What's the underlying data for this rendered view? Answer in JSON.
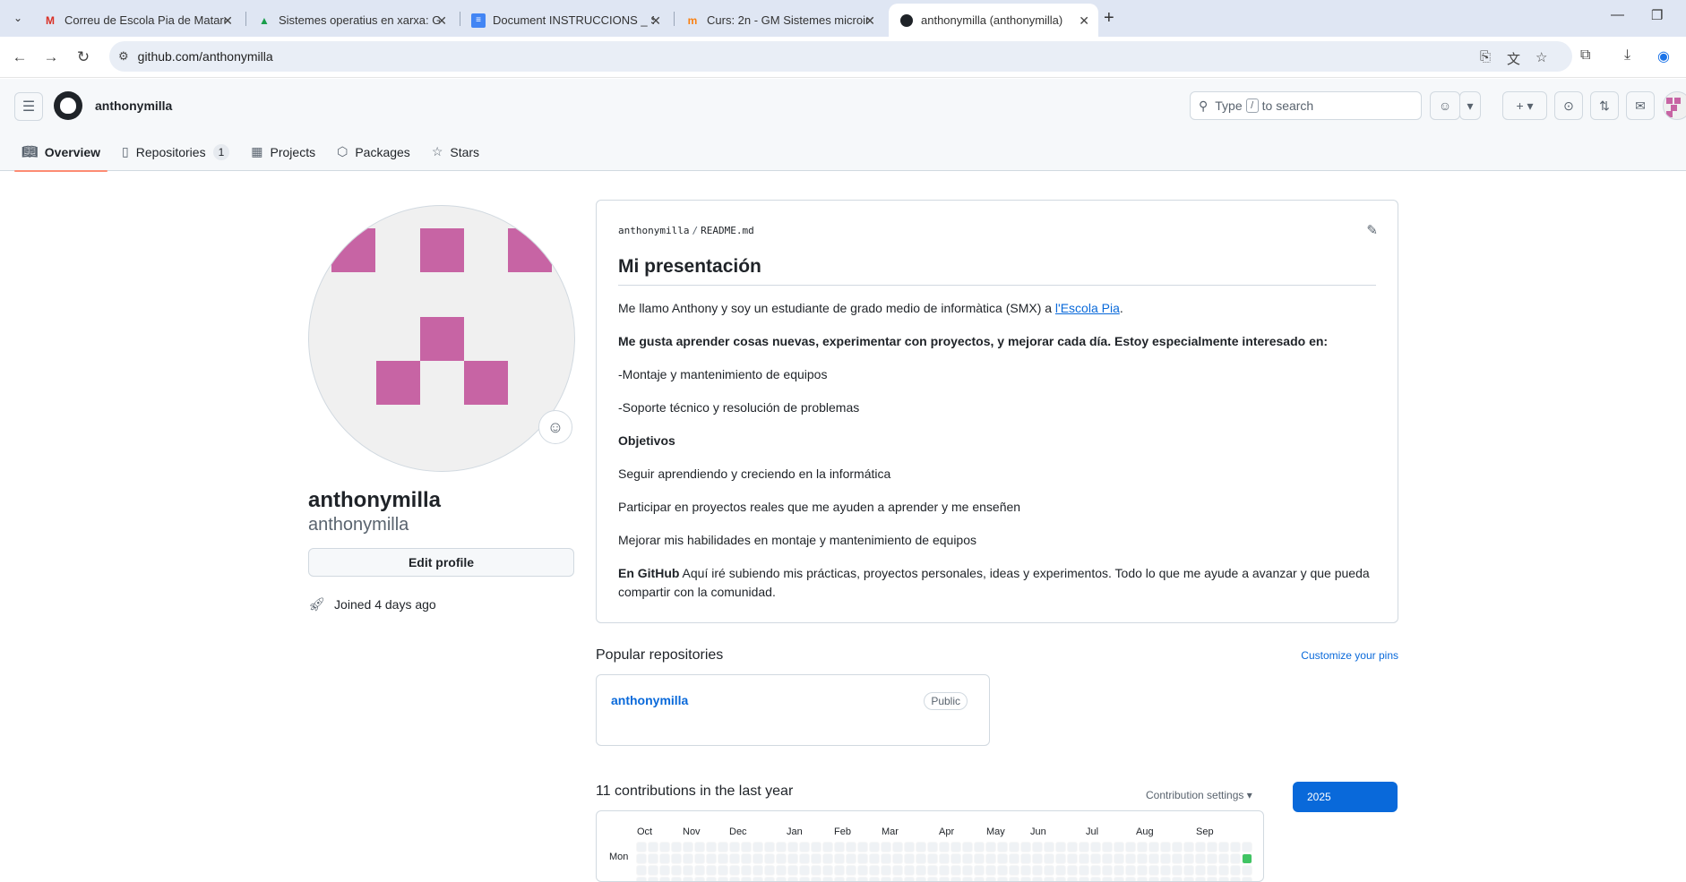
{
  "browser": {
    "tabs": [
      {
        "title": "Correu de Escola Pia de Mataró",
        "icon": "gmail-icon"
      },
      {
        "title": "Sistemes operatius en xarxa: Go",
        "icon": "drive-icon"
      },
      {
        "title": "Document INSTRUCCIONS _ SM",
        "icon": "docs-icon"
      },
      {
        "title": "Curs: 2n - GM Sistemes microin",
        "icon": "moodle-icon"
      },
      {
        "title": "anthonymilla (anthonymilla)",
        "icon": "github-icon"
      }
    ],
    "url": "github.com/anthonymilla"
  },
  "header": {
    "username": "anthonymilla",
    "search_prefix": "Type",
    "search_key": "/",
    "search_suffix": "to search"
  },
  "nav": {
    "overview": "Overview",
    "repositories": "Repositories",
    "repositories_count": "1",
    "projects": "Projects",
    "packages": "Packages",
    "stars": "Stars"
  },
  "profile": {
    "name": "anthonymilla",
    "login": "anthonymilla",
    "edit_label": "Edit profile",
    "joined": "Joined 4 days ago"
  },
  "readme": {
    "path_user": "anthonymilla",
    "path_file": "README.md",
    "heading": "Mi presentación",
    "intro_text": "Me llamo Anthony y soy un estudiante de grado medio de informàtica (SMX) a ",
    "intro_link": "l'Escola Pia",
    "intro_end": ".",
    "interests_bold": "Me gusta aprender cosas nuevas, experimentar con proyectos, y mejorar cada día. Estoy especialmente interesado en:",
    "item1": "-Montaje y mantenimiento de equipos",
    "item2": "-Soporte técnico y resolución de problemas",
    "objectives_bold": "Objetivos",
    "obj1": "Seguir aprendiendo y creciendo en la informática",
    "obj2": "Participar en proyectos reales que me ayuden a aprender y me enseñen",
    "obj3": "Mejorar mis habilidades en montaje y mantenimiento de equipos",
    "github_bold": "En GitHub",
    "github_text": " Aquí iré subiendo mis prácticas, proyectos personales, ideas y experimentos. Todo lo que me ayude a avanzar y que pueda compartir con la comunidad."
  },
  "popular": {
    "heading": "Popular repositories",
    "customize": "Customize your pins",
    "repo_name": "anthonymilla",
    "repo_visibility": "Public"
  },
  "contributions": {
    "heading": "11 contributions in the last year",
    "settings": "Contribution settings",
    "year": "2025",
    "months": [
      "Oct",
      "Nov",
      "Dec",
      "Jan",
      "Feb",
      "Mar",
      "Apr",
      "May",
      "Jun",
      "Jul",
      "Aug",
      "Sep"
    ],
    "day_label": "Mon"
  },
  "colors": {
    "accent": "#0969da",
    "tab_underline": "#fd8c73",
    "identicon": "#c764a4",
    "contrib_filled": "#40c463"
  }
}
